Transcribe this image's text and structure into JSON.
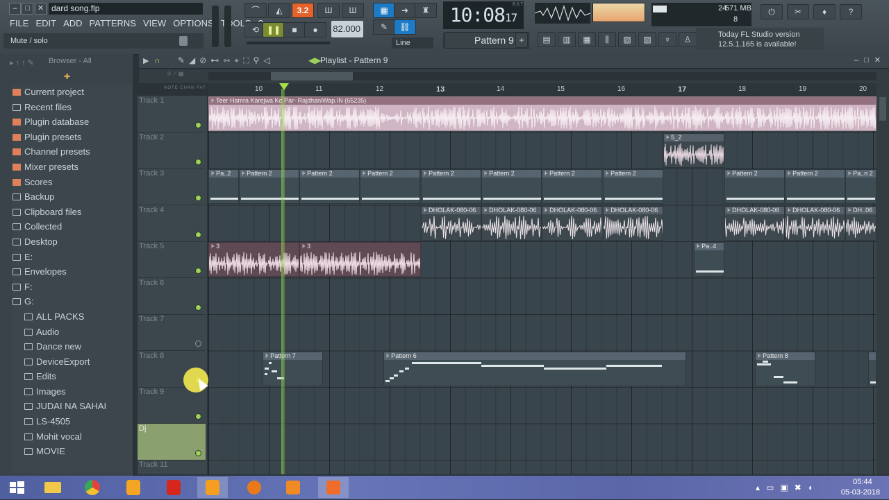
{
  "window": {
    "filename": "dard song.flp"
  },
  "menu": [
    "FILE",
    "EDIT",
    "ADD",
    "PATTERNS",
    "VIEW",
    "OPTIONS",
    "TOOLS",
    "?"
  ],
  "hint": "Mute / solo",
  "transport": {
    "mode_label": "3.2",
    "tempo": "82.000",
    "snap": "Line"
  },
  "clock": {
    "main": "10:08",
    "sub": "17",
    "tiny": "B:S:T"
  },
  "cpu": {
    "value": "24",
    "memory": "571 MB",
    "polyphony": "8"
  },
  "pattern_selector": "Pattern 9",
  "news": {
    "line1": "Today  FL Studio version",
    "line2": "12.5.1.165 is available!"
  },
  "browser": {
    "header": "Browser - All",
    "items": [
      {
        "label": "Current project",
        "type": "hl"
      },
      {
        "label": "Recent files",
        "type": "folder"
      },
      {
        "label": "Plugin database",
        "type": "hl"
      },
      {
        "label": "Plugin presets",
        "type": "hl"
      },
      {
        "label": "Channel presets",
        "type": "hl"
      },
      {
        "label": "Mixer presets",
        "type": "hl"
      },
      {
        "label": "Scores",
        "type": "hl"
      },
      {
        "label": "Backup",
        "type": "folder"
      },
      {
        "label": "Clipboard files",
        "type": "folder"
      },
      {
        "label": "Collected",
        "type": "folder"
      },
      {
        "label": "Desktop",
        "type": "folder"
      },
      {
        "label": "E:",
        "type": "folder"
      },
      {
        "label": "Envelopes",
        "type": "folder"
      },
      {
        "label": "F:",
        "type": "folder"
      },
      {
        "label": "G:",
        "type": "folder"
      },
      {
        "label": "ALL PACKS",
        "type": "sub"
      },
      {
        "label": "Audio",
        "type": "sub"
      },
      {
        "label": "Dance new",
        "type": "sub"
      },
      {
        "label": "DeviceExport",
        "type": "sub"
      },
      {
        "label": "Edits",
        "type": "sub"
      },
      {
        "label": "Images",
        "type": "sub"
      },
      {
        "label": "JUDAI NA SAHAI",
        "type": "sub"
      },
      {
        "label": "LS-4505",
        "type": "sub"
      },
      {
        "label": "Mohit vocal",
        "type": "sub"
      },
      {
        "label": "MOVIE",
        "type": "sub"
      }
    ]
  },
  "playlist": {
    "title": "Playlist - Pattern 9",
    "ruler": [
      "10",
      "11",
      "12",
      "13",
      "14",
      "15",
      "16",
      "17",
      "18",
      "19",
      "20"
    ],
    "ruler_bold": [
      "13",
      "17"
    ],
    "tracks": [
      "Track 1",
      "Track 2",
      "Track 3",
      "Track 4",
      "Track 5",
      "Track 6",
      "Track 7",
      "Track 8",
      "Track 9",
      "Dj",
      "Track 11"
    ],
    "clips": {
      "t1": "Teer Hamra Karejwa Ke Par- RajdhaniWap.IN (65235)",
      "t2": "5_2",
      "t3_first": "Pa..2",
      "t3": "Pattern 2",
      "t3_last": "Pa..n 2",
      "t4": "DHOLAK-080-06",
      "t4_last": "DH..06",
      "t5": "3",
      "t5_last": "Pa..4",
      "t8a": "Pattern 7",
      "t8b": "Pattern 6",
      "t8c": "Pattern 8"
    }
  },
  "taskbar": {
    "time": "05:44",
    "date": "05-03-2018"
  }
}
